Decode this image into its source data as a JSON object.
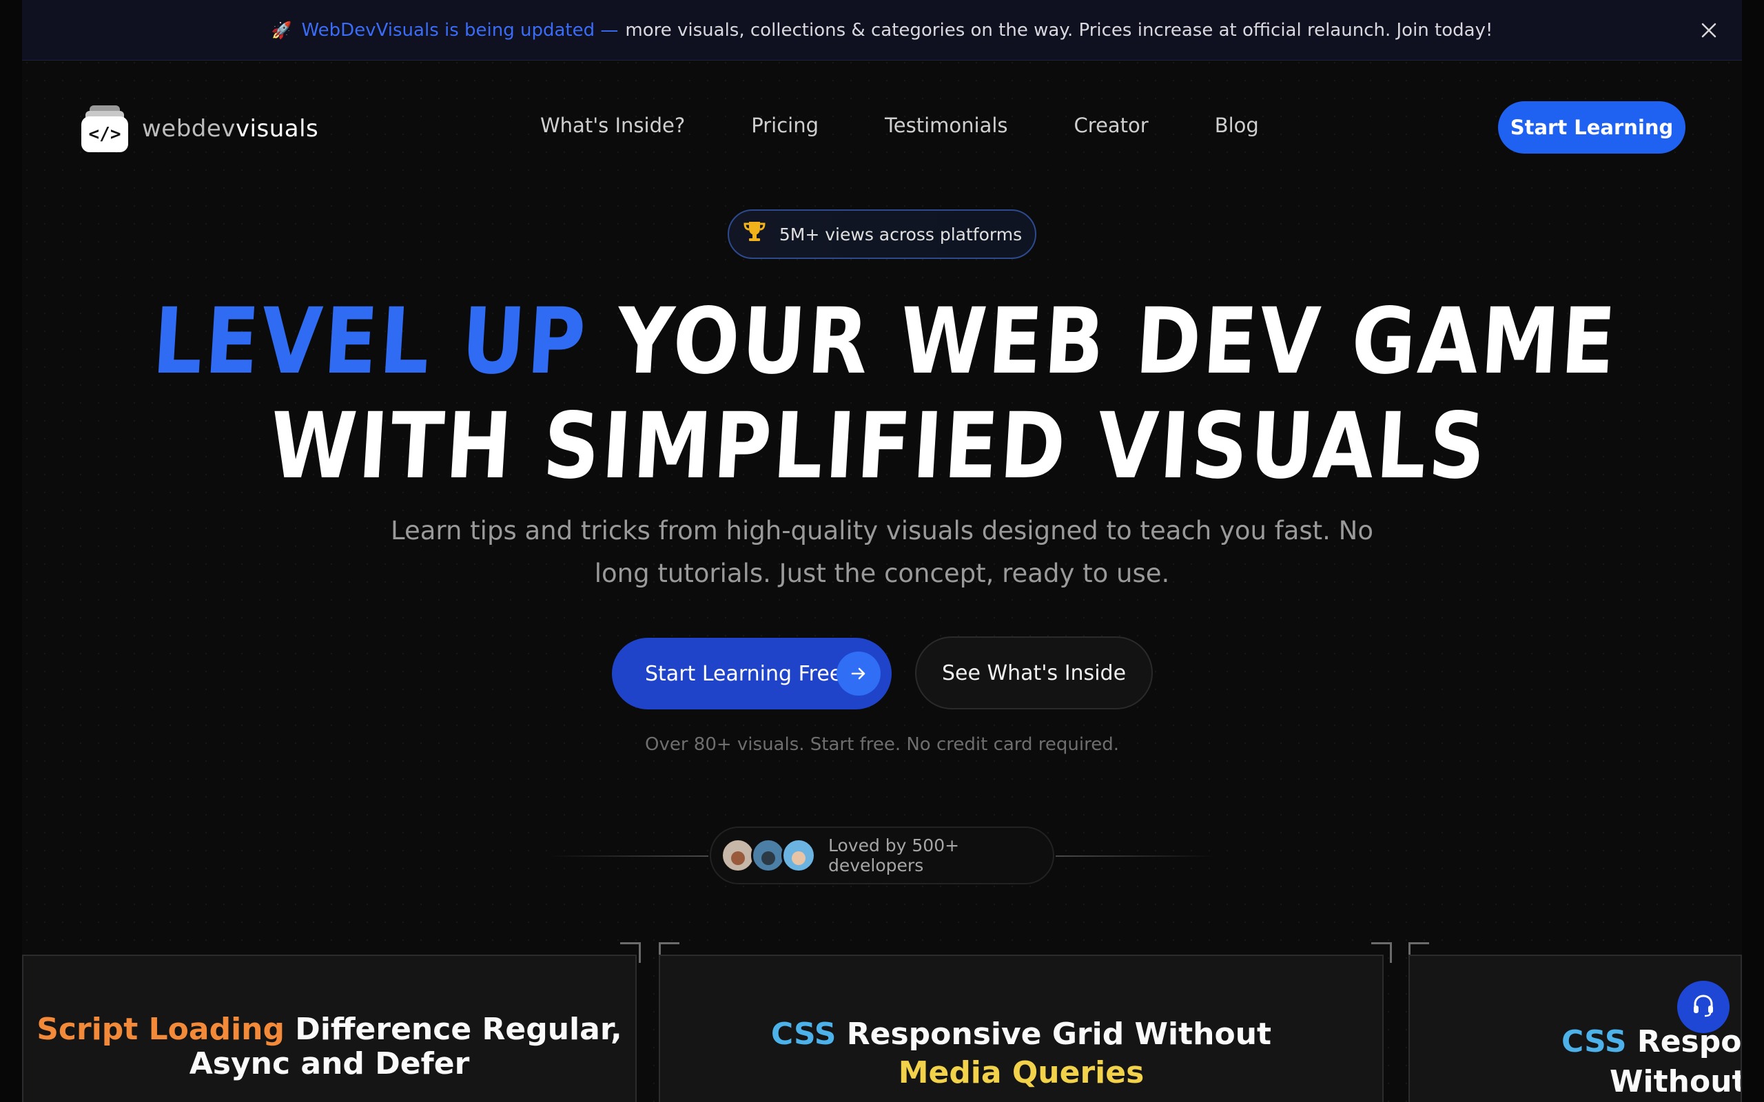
{
  "announcement": {
    "accent_text": "WebDevVisuals is being updated —",
    "text": "more visuals, collections & categories on the way. Prices increase at official relaunch. Join today!"
  },
  "nav": {
    "logo_light": "webdev",
    "logo_bold": "visuals",
    "links": [
      "What's Inside?",
      "Pricing",
      "Testimonials",
      "Creator",
      "Blog"
    ],
    "cta": "Start Learning"
  },
  "hero": {
    "badge": "5M+ views across platforms",
    "headline_accent": "LEVEL UP",
    "headline_rest_1": " YOUR WEB DEV GAME",
    "headline_line_2": "WITH SIMPLIFIED VISUALS",
    "subhead": "Learn tips and tricks from high-quality visuals designed to teach you fast. No long tutorials. Just the concept, ready to use.",
    "cta_primary": "Start Learning Free",
    "cta_secondary": "See What's Inside",
    "note": "Over 80+ visuals. Start free. No credit card required.",
    "loved_by": "Loved by 500+ developers"
  },
  "cards": [
    {
      "accent": "Script Loading",
      "rest_1": " Difference Regular,",
      "line_2": "Async and Defer"
    },
    {
      "accent": "CSS",
      "rest_1": " Responsive Grid Without",
      "line_2": "Media Queries"
    },
    {
      "accent": "CSS",
      "rest_1": " Responsi",
      "line_2": "Without M"
    }
  ],
  "colors": {
    "brand_blue": "#1f62f2",
    "accent_orange": "#f28a3a",
    "accent_cyan": "#4db1ea",
    "accent_yellow": "#f2d24b"
  }
}
